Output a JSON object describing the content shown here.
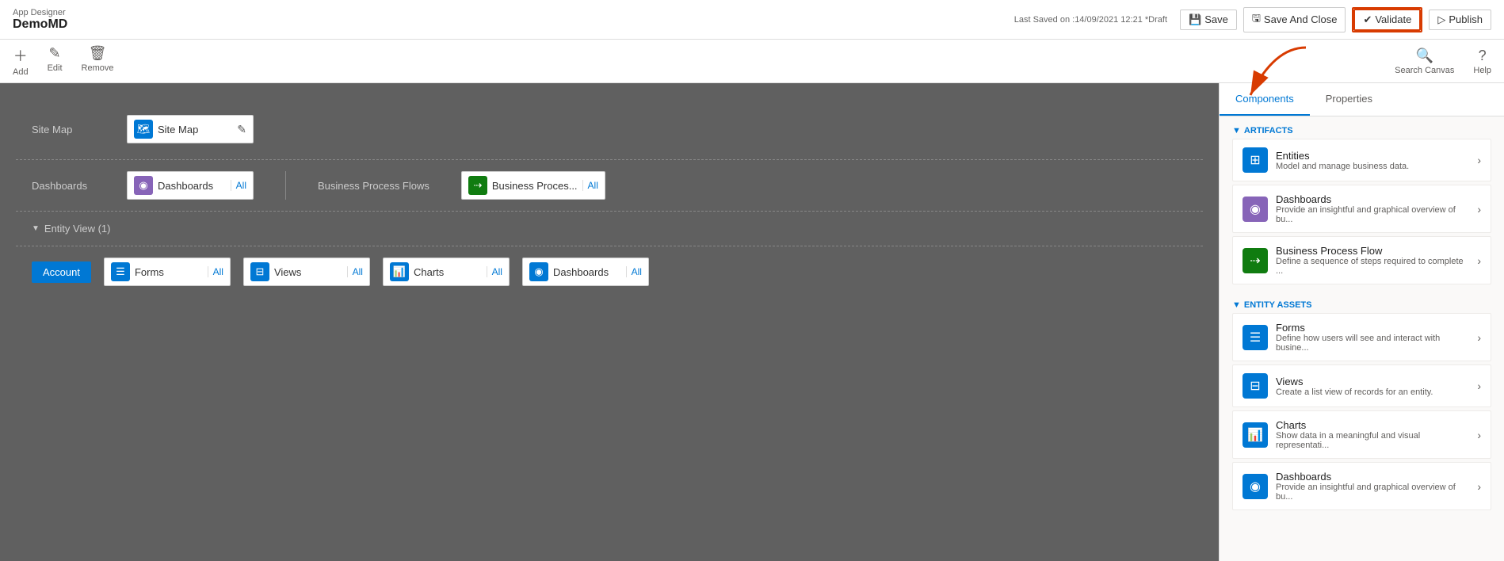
{
  "header": {
    "app_designer_label": "App Designer",
    "app_name": "DemoMD",
    "last_saved": "Last Saved on :14/09/2021 12:21 *Draft",
    "save_label": "Save",
    "save_close_label": "Save And Close",
    "validate_label": "Validate",
    "publish_label": "Publish"
  },
  "toolbar": {
    "add_label": "Add",
    "edit_label": "Edit",
    "remove_label": "Remove",
    "search_canvas_label": "Search Canvas",
    "help_label": "Help"
  },
  "canvas": {
    "site_map_label": "Site Map",
    "site_map_component": "Site Map",
    "dashboards_label": "Dashboards",
    "dashboards_component": "Dashboards",
    "dashboards_all": "All",
    "bpf_label": "Business Process Flows",
    "bpf_component": "Business Proces...",
    "bpf_all": "All",
    "entity_view_label": "Entity View (1)",
    "account_label": "Account",
    "forms_label": "Forms",
    "forms_all": "All",
    "views_label": "Views",
    "views_all": "All",
    "charts_label": "Charts",
    "charts_all": "All",
    "entity_dashboards_label": "Dashboards",
    "entity_dashboards_all": "All"
  },
  "sidebar": {
    "components_tab": "Components",
    "properties_tab": "Properties",
    "artifacts_section": "ARTIFACTS",
    "entity_assets_section": "ENTITY ASSETS",
    "items": [
      {
        "id": "entities",
        "title": "Entities",
        "desc": "Model and manage business data.",
        "icon_color": "#0078d4",
        "icon_symbol": "⊞"
      },
      {
        "id": "dashboards",
        "title": "Dashboards",
        "desc": "Provide an insightful and graphical overview of bu...",
        "icon_color": "#8764b8",
        "icon_symbol": "◉"
      },
      {
        "id": "bpf",
        "title": "Business Process Flow",
        "desc": "Define a sequence of steps required to complete ...",
        "icon_color": "#107c10",
        "icon_symbol": "⇢"
      }
    ],
    "entity_items": [
      {
        "id": "forms",
        "title": "Forms",
        "desc": "Define how users will see and interact with busine...",
        "icon_color": "#0078d4",
        "icon_symbol": "☰"
      },
      {
        "id": "views",
        "title": "Views",
        "desc": "Create a list view of records for an entity.",
        "icon_color": "#0078d4",
        "icon_symbol": "⊟"
      },
      {
        "id": "charts",
        "title": "Charts",
        "desc": "Show data in a meaningful and visual representati...",
        "icon_color": "#0078d4",
        "icon_symbol": "📊"
      },
      {
        "id": "entity-dashboards",
        "title": "Dashboards",
        "desc": "Provide an insightful and graphical overview of bu...",
        "icon_color": "#0078d4",
        "icon_symbol": "◉"
      }
    ]
  }
}
